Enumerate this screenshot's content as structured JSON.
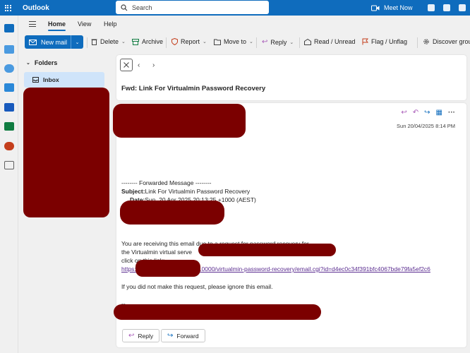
{
  "app": {
    "name": "Outlook",
    "search_placeholder": "Search",
    "meet_now": "Meet Now"
  },
  "menu": {
    "tabs": [
      "Home",
      "View",
      "Help"
    ]
  },
  "toolbar": {
    "new_mail": "New mail",
    "delete": "Delete",
    "archive": "Archive",
    "report": "Report",
    "move_to": "Move to",
    "reply": "Reply",
    "read_unread": "Read / Unread",
    "flag_unflag": "Flag / Unflag",
    "discover_groups": "Discover grou"
  },
  "folders": {
    "heading": "Folders",
    "items": [
      "Inbox"
    ]
  },
  "message": {
    "subject": "Fwd: Link For Virtualmin Password Recovery",
    "date": "Sun 20/04/2025 8:14 PM",
    "forward_header": "-------- Forwarded Message --------",
    "subject_label": "Subject:",
    "subject_value": "Link For Virtualmin Password Recovery",
    "date_label": "Date:",
    "date_value": "Sun, 20 Apr 2025 20:13:25 +1000 (AEST)",
    "line1": "You are receiving this email due to a request for password recovery for",
    "line2a": "the Virtualmin virtual serve",
    "line2b": ",",
    "line3": "click on this link:",
    "link_start": "https:",
    "link_end": "10000/virtualmin-password-recovery/email.cgi?id=d4ec0c34f391bfc4067bde79fa5ef2c6",
    "ignore": "If you did not make this request, please ignore this email.",
    "sig": "--",
    "reply_button": "Reply",
    "forward_button": "Forward"
  },
  "colors": {
    "brand": "#0f6cbd",
    "redaction": "#7b0000",
    "selected_folder": "#cfe4fa",
    "link": "#5b2d90"
  }
}
